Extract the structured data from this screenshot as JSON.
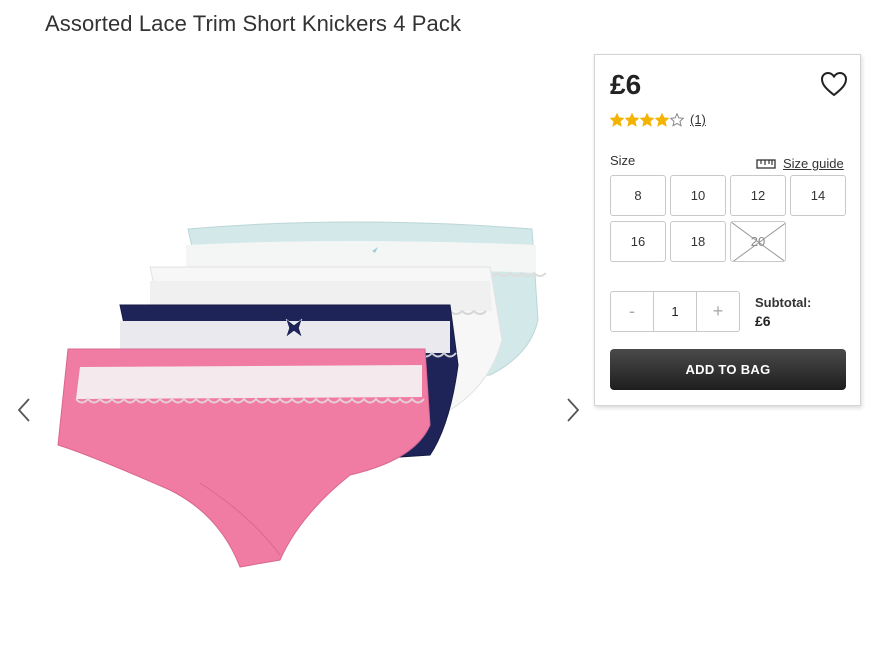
{
  "product": {
    "title": "Assorted Lace Trim Short Knickers 4 Pack",
    "price": "£6",
    "rating": 4,
    "rating_max": 5,
    "review_count": "(1)"
  },
  "sizes": {
    "label": "Size",
    "guide_label": "Size guide",
    "options": [
      {
        "label": "8",
        "available": true
      },
      {
        "label": "10",
        "available": true
      },
      {
        "label": "12",
        "available": true
      },
      {
        "label": "14",
        "available": true
      },
      {
        "label": "16",
        "available": true
      },
      {
        "label": "18",
        "available": true
      },
      {
        "label": "20",
        "available": false
      }
    ]
  },
  "quantity": {
    "minus_label": "-",
    "value": "1",
    "plus_label": "+"
  },
  "subtotal": {
    "label": "Subtotal:",
    "amount": "£6"
  },
  "cta": {
    "add_to_bag_label": "ADD TO BAG"
  },
  "colors": {
    "star": "#f5b301",
    "button_dark": "#2a2a2a",
    "pink": "#f07ca4",
    "navy": "#1e2458",
    "white": "#f6f6f6",
    "mint": "#cfe6e6"
  },
  "icons": {
    "prev": "chevron-left-icon",
    "next": "chevron-right-icon",
    "wishlist": "heart-outline-icon",
    "size_guide": "ruler-icon",
    "star": "star-icon"
  }
}
